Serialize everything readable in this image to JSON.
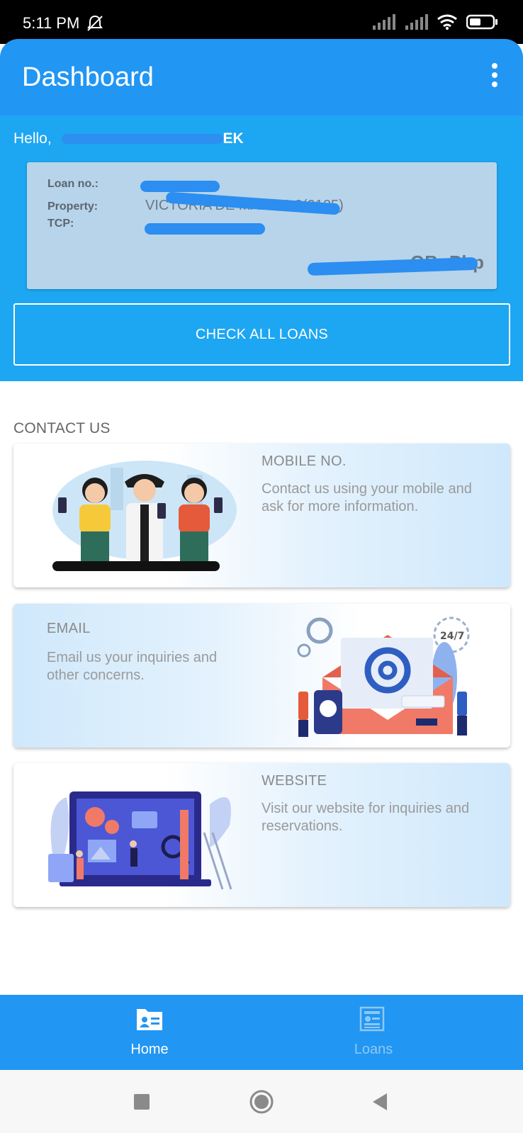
{
  "status_bar": {
    "time": "5:11 PM",
    "battery_icon": "battery-icon",
    "wifi_icon": "wifi-icon"
  },
  "app_bar": {
    "title": "Dashboard"
  },
  "greeting": {
    "prefix": "Hello,",
    "name_suffix": "EK"
  },
  "loan_card": {
    "loan_no_label": "Loan no.:",
    "property_label": "Property:",
    "property_value": "VICTORIA DE MANILA 2(0125)",
    "tcp_label": "TCP:",
    "ob_label": "OB: Php"
  },
  "check_loans_button": "CHECK ALL LOANS",
  "contact": {
    "title": "CONTACT US",
    "cards": [
      {
        "title": "MOBILE NO.",
        "desc": "Contact us using your mobile and ask for more information."
      },
      {
        "title": "EMAIL",
        "desc": "Email us your inquiries and other concerns."
      },
      {
        "title": "WEBSITE",
        "desc": "Visit our website for inquiries and reservations."
      }
    ]
  },
  "bottom_nav": {
    "items": [
      {
        "label": "Home",
        "active": true
      },
      {
        "label": "Loans",
        "active": false
      }
    ]
  },
  "email_badge": "24/7",
  "colors": {
    "primary": "#2196f3",
    "header": "#1da6f2",
    "loan_card": "#b7d4ea"
  }
}
